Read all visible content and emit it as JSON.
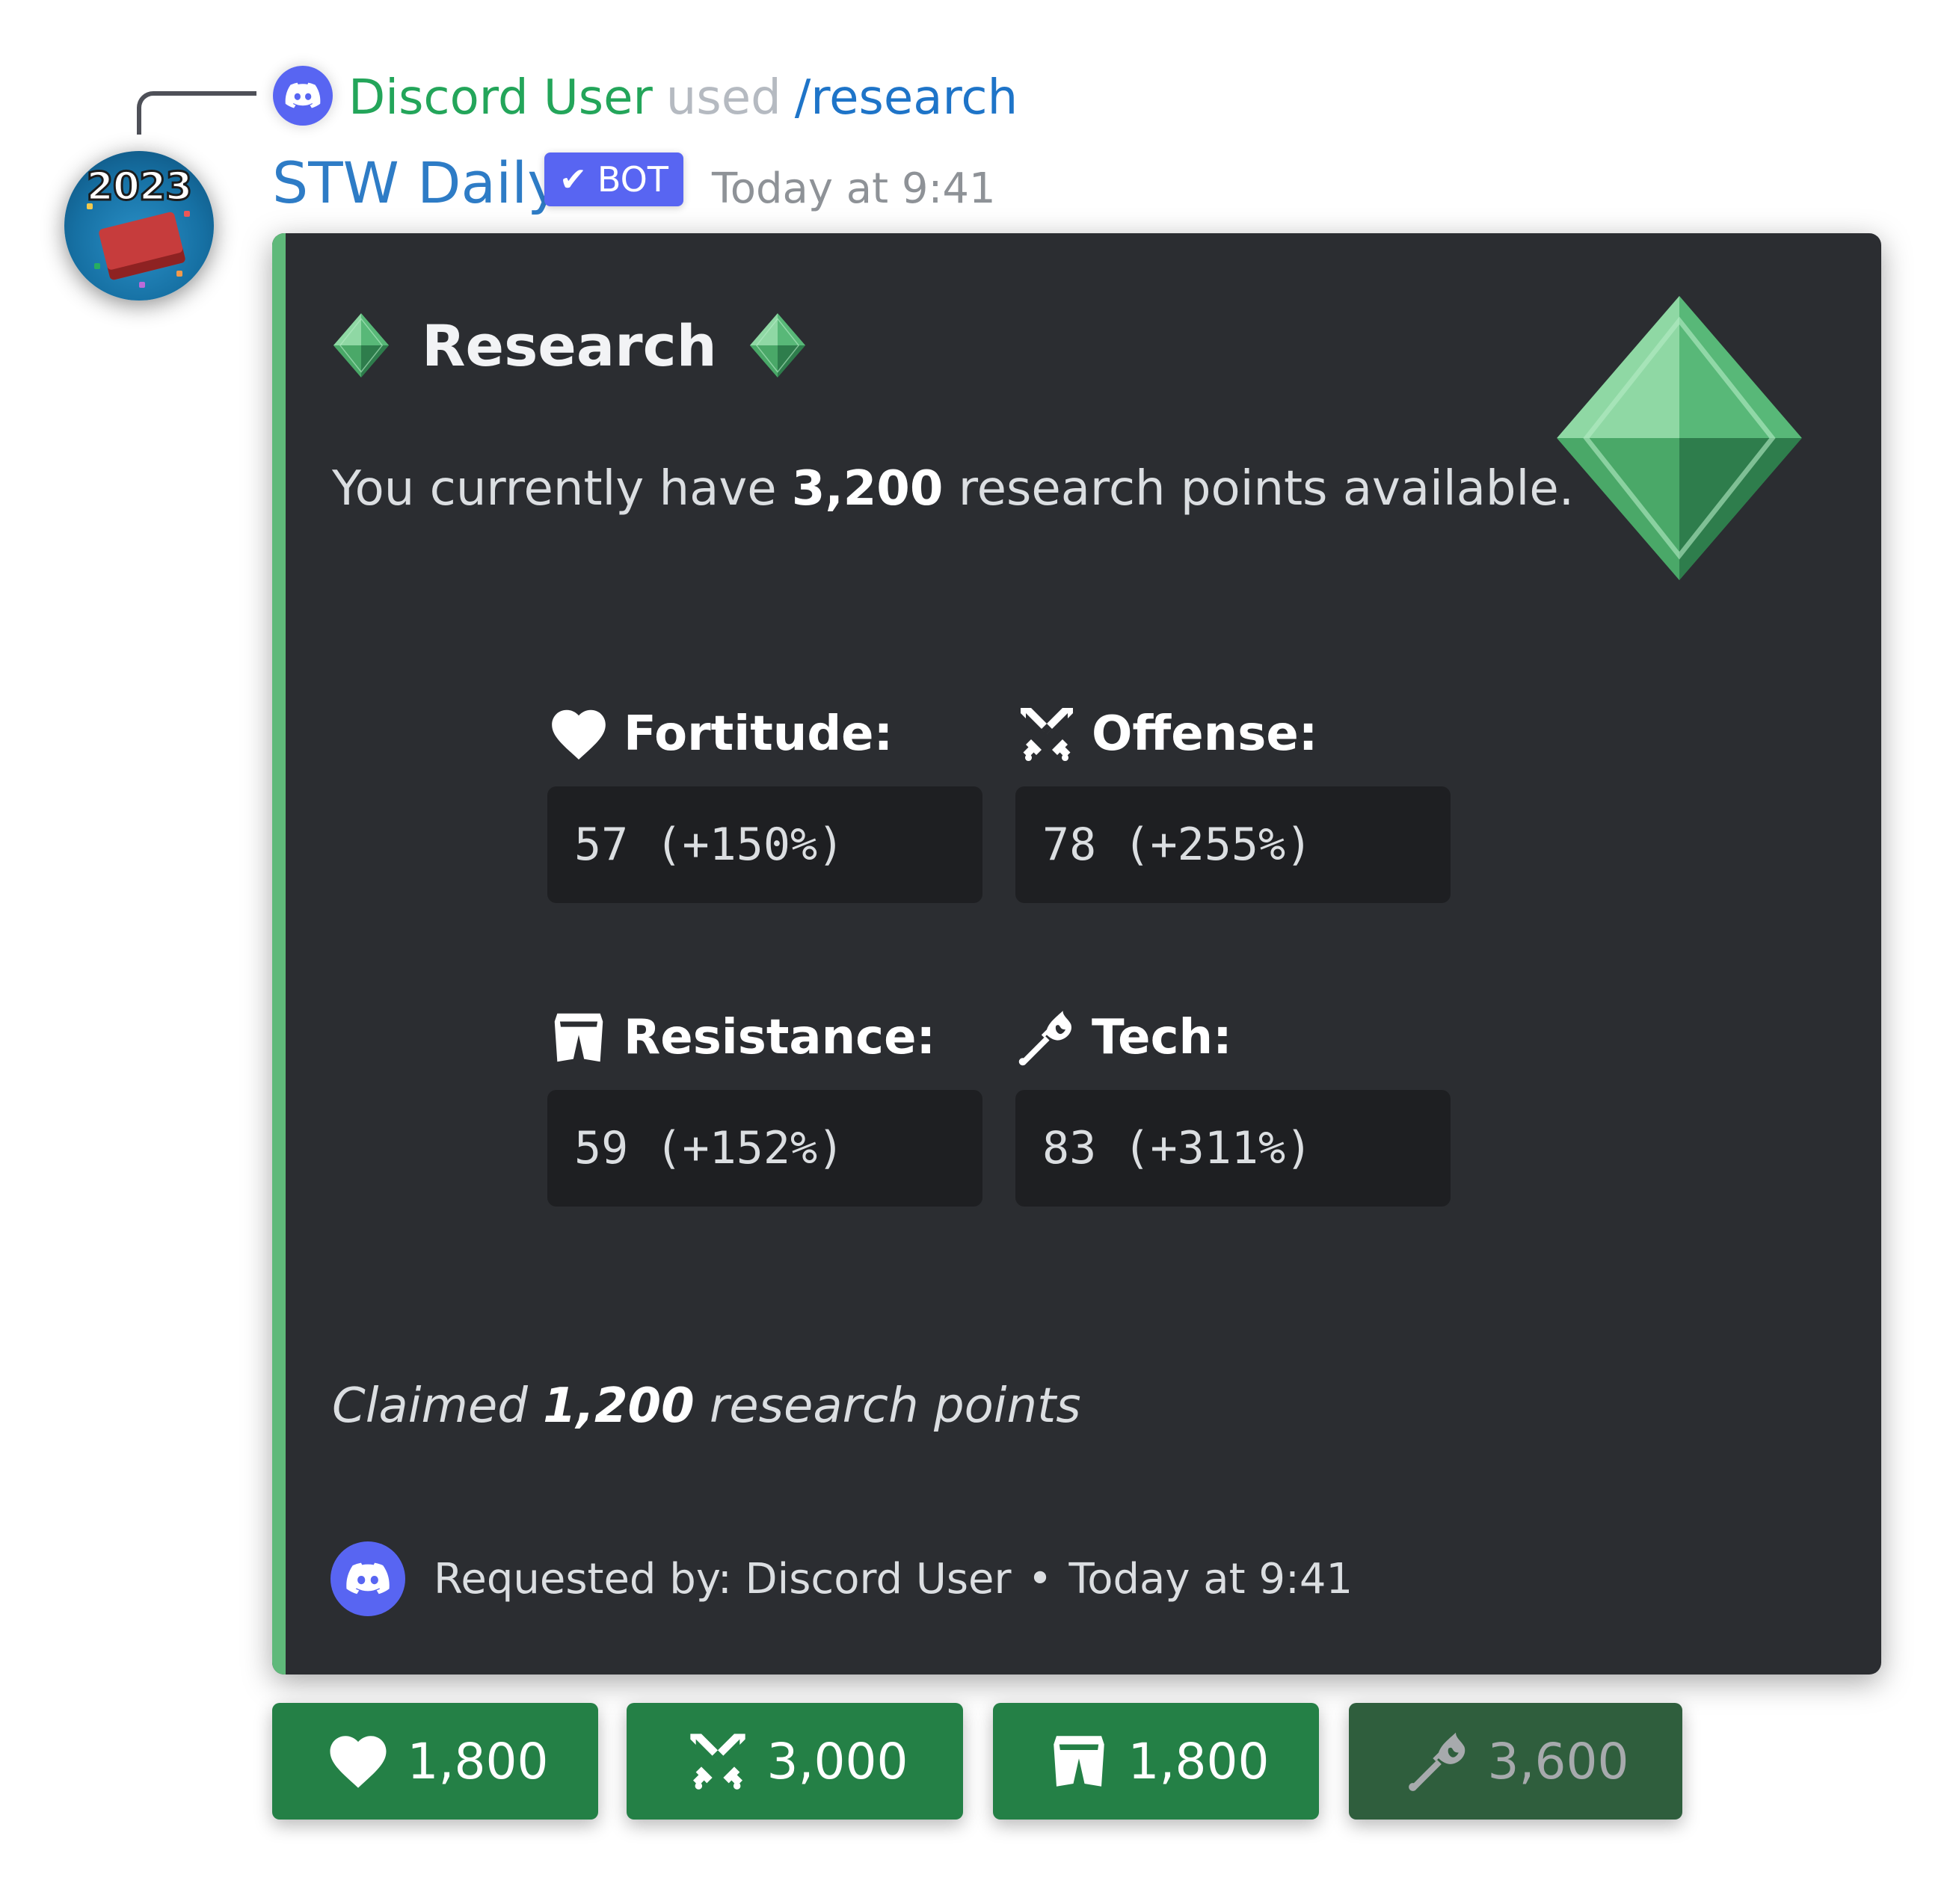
{
  "reply": {
    "user": "Discord User",
    "used": "used",
    "command": "/research"
  },
  "message": {
    "bot_name": "STW Daily",
    "badge": "BOT",
    "timestamp": "Today at 9:41",
    "avatar_text": "2023"
  },
  "embed": {
    "accent_color": "#5fb97a",
    "title": "Research",
    "description": {
      "prefix": "You currently have ",
      "points": "3,200",
      "suffix": " research points available."
    },
    "fields": [
      {
        "icon": "heart-icon",
        "label": "Fortitude:",
        "value": "57 (+150%)"
      },
      {
        "icon": "crossed-swords-icon",
        "label": "Offense:",
        "value": "78 (+255%)"
      },
      {
        "icon": "armor-icon",
        "label": "Resistance:",
        "value": "59 (+152%)"
      },
      {
        "icon": "tech-torch-icon",
        "label": "Tech:",
        "value": "83 (+311%)"
      }
    ],
    "claimed": {
      "prefix": "Claimed ",
      "points": "1,200",
      "suffix": " research points"
    },
    "footer": {
      "text": "Requested by: Discord User",
      "separator": "•",
      "time": "Today at 9:41"
    }
  },
  "buttons": [
    {
      "icon": "heart-icon",
      "label": "1,800",
      "disabled": false
    },
    {
      "icon": "crossed-swords-icon",
      "label": "3,000",
      "disabled": false
    },
    {
      "icon": "armor-icon",
      "label": "1,800",
      "disabled": false
    },
    {
      "icon": "tech-torch-icon",
      "label": "3,600",
      "disabled": true
    }
  ],
  "colors": {
    "button_green": "#248046",
    "button_disabled": "#2f5e3d",
    "blurple": "#5865f2",
    "embed_bg": "#2b2d31"
  }
}
